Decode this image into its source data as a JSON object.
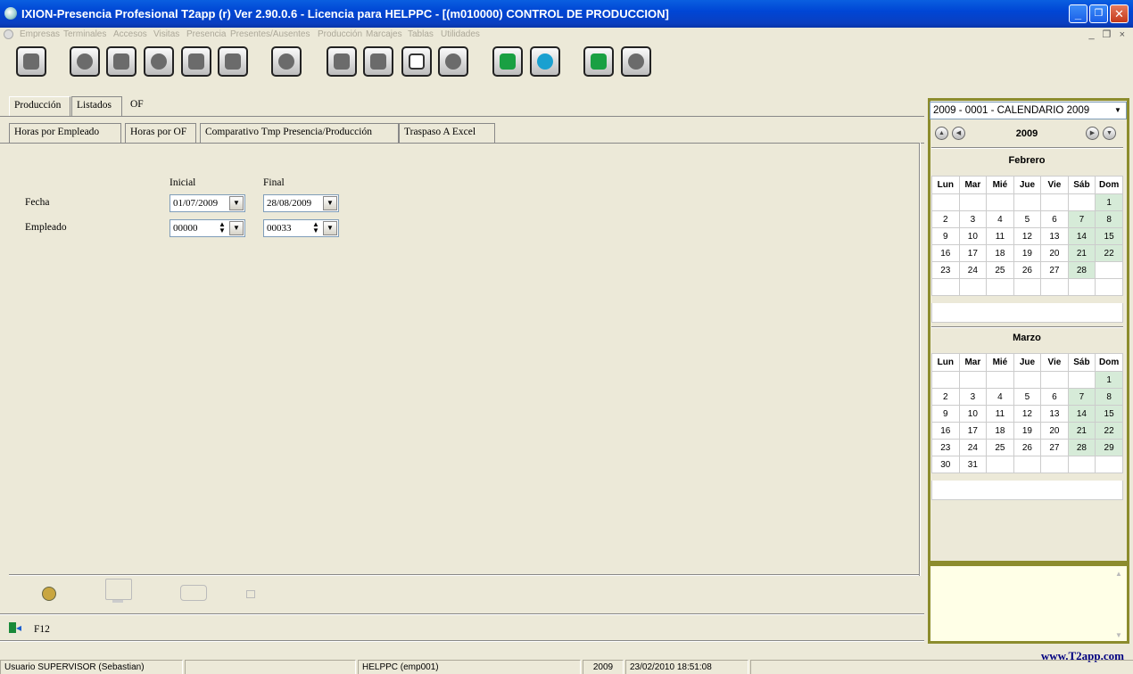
{
  "window": {
    "title": "IXION-Presencia Profesional T2app (r) Ver 2.90.0.6   -   Licencia para HELPPC - [(m010000)  CONTROL DE PRODUCCION]",
    "minimize": "_",
    "maximize": "❐",
    "close": "✕"
  },
  "menu": {
    "items": [
      "Empresas",
      "Terminales",
      "Accesos",
      "Visitas",
      "Presencia",
      "Presentes/Ausentes",
      "Producción",
      "Marcajes",
      "Tablas",
      "Utilidades"
    ],
    "mdi_controls": "_ ❐ ×"
  },
  "toolbar": {
    "buttons": [
      "empresas",
      "terminales",
      "accesos",
      "configuracion",
      "terminal",
      "imprimir",
      "informacion",
      "visitas",
      "empleados",
      "calendario",
      "reloj",
      "ayuda-online",
      "info",
      "calculadora",
      "salir"
    ]
  },
  "tabs_main": [
    "Producción",
    "Listados",
    "OF"
  ],
  "tabs_sub": [
    "Horas por Empleado",
    "Horas por OF",
    "Comparativo Tmp Presencia/Producción",
    "Traspaso A Excel"
  ],
  "form": {
    "col_inicial": "Inicial",
    "col_final": "Final",
    "fecha_label": "Fecha",
    "empleado_label": "Empleado",
    "fecha_inicial": "01/07/2009",
    "fecha_final": "28/08/2009",
    "empleado_inicial": "00000",
    "empleado_final": "00033"
  },
  "bottom": {
    "shortcut": "F12"
  },
  "calendar": {
    "selector": "2009 - 0001 - CALENDARIO 2009",
    "year": "2009",
    "weekdays": [
      "Lun",
      "Mar",
      "Mié",
      "Jue",
      "Vie",
      "Sáb",
      "Dom"
    ],
    "months": [
      {
        "name": "Febrero",
        "rows": [
          [
            "",
            "",
            "",
            "",
            "",
            "",
            "1"
          ],
          [
            "2",
            "3",
            "4",
            "5",
            "6",
            "7",
            "8"
          ],
          [
            "9",
            "10",
            "11",
            "12",
            "13",
            "14",
            "15"
          ],
          [
            "16",
            "17",
            "18",
            "19",
            "20",
            "21",
            "22"
          ],
          [
            "23",
            "24",
            "25",
            "26",
            "27",
            "28",
            ""
          ],
          [
            "",
            "",
            "",
            "",
            "",
            "",
            ""
          ]
        ]
      },
      {
        "name": "Marzo",
        "rows": [
          [
            "",
            "",
            "",
            "",
            "",
            "",
            "1"
          ],
          [
            "2",
            "3",
            "4",
            "5",
            "6",
            "7",
            "8"
          ],
          [
            "9",
            "10",
            "11",
            "12",
            "13",
            "14",
            "15"
          ],
          [
            "16",
            "17",
            "18",
            "19",
            "20",
            "21",
            "22"
          ],
          [
            "23",
            "24",
            "25",
            "26",
            "27",
            "28",
            "29"
          ],
          [
            "30",
            "31",
            "",
            "",
            "",
            "",
            ""
          ]
        ]
      }
    ],
    "weekend_color": "#d6ebd8"
  },
  "website": "www.T2app.com",
  "status": {
    "user": "Usuario SUPERVISOR (Sebastian)",
    "blank": "",
    "machine": "HELPPC  (emp001)",
    "year": "2009",
    "datetime": "23/02/2010  18:51:08"
  },
  "colors": {
    "titlebar": "#0046d5",
    "frame_accent": "#8c8c2d",
    "background": "#ece9d8"
  }
}
